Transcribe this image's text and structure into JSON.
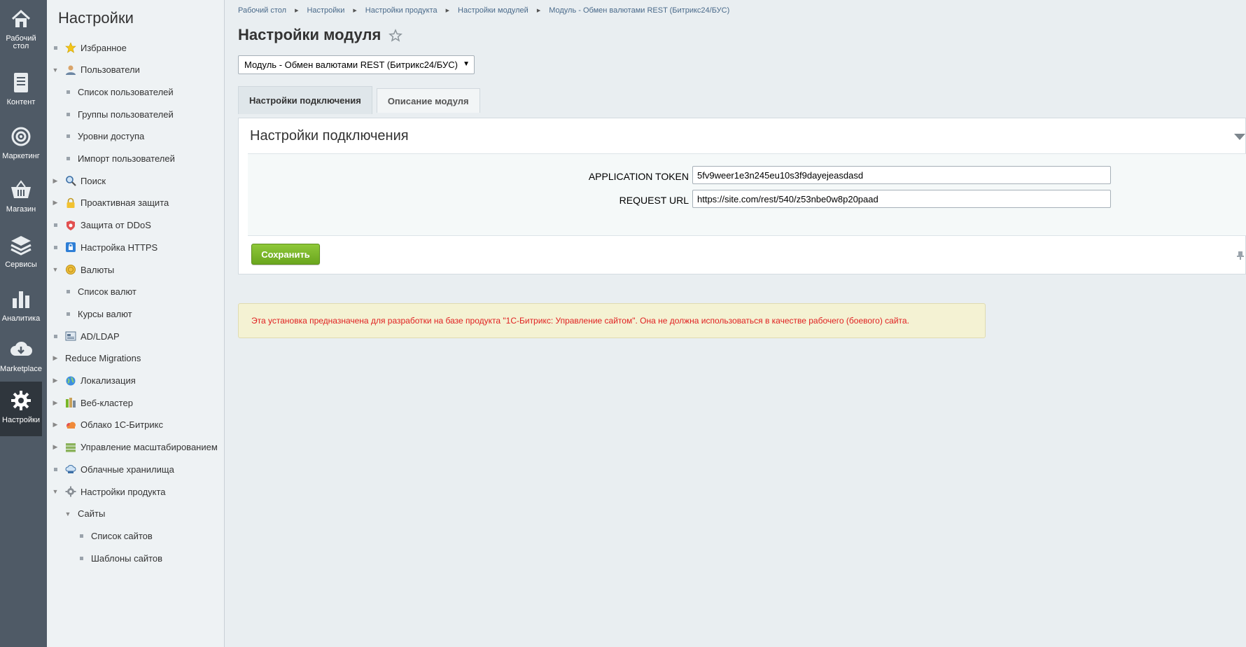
{
  "rail": {
    "items": [
      {
        "label": "Рабочий стол",
        "icon": "home-icon"
      },
      {
        "label": "Контент",
        "icon": "document-icon"
      },
      {
        "label": "Маркетинг",
        "icon": "target-icon"
      },
      {
        "label": "Магазин",
        "icon": "basket-icon"
      },
      {
        "label": "Сервисы",
        "icon": "layers-icon"
      },
      {
        "label": "Аналитика",
        "icon": "bar-chart-icon"
      },
      {
        "label": "Marketplace",
        "icon": "cloud-download-icon"
      },
      {
        "label": "Настройки",
        "icon": "gear-icon",
        "active": true
      }
    ]
  },
  "panel": {
    "title": "Настройки",
    "items": [
      {
        "label": "Избранное",
        "icon": "star-icon",
        "marker": "bullet"
      },
      {
        "label": "Пользователи",
        "icon": "user-icon",
        "marker": "expanded"
      },
      {
        "label": "Список пользователей",
        "marker": "bullet",
        "level": 1
      },
      {
        "label": "Группы пользователей",
        "marker": "bullet",
        "level": 1
      },
      {
        "label": "Уровни доступа",
        "marker": "bullet",
        "level": 1
      },
      {
        "label": "Импорт пользователей",
        "marker": "bullet",
        "level": 1
      },
      {
        "label": "Поиск",
        "icon": "magnifier-icon",
        "marker": "collapsed"
      },
      {
        "label": "Проактивная защита",
        "icon": "lock-icon",
        "marker": "collapsed"
      },
      {
        "label": "Защита от DDoS",
        "icon": "shield-icon",
        "marker": "bullet"
      },
      {
        "label": "Настройка HTTPS",
        "icon": "https-lock-icon",
        "marker": "bullet"
      },
      {
        "label": "Валюты",
        "icon": "coin-icon",
        "marker": "expanded"
      },
      {
        "label": "Список валют",
        "marker": "bullet",
        "level": 1
      },
      {
        "label": "Курсы валют",
        "marker": "bullet",
        "level": 1
      },
      {
        "label": "AD/LDAP",
        "icon": "directory-icon",
        "marker": "bullet"
      },
      {
        "label": "Reduce Migrations",
        "marker": "collapsed"
      },
      {
        "label": "Локализация",
        "icon": "globe-icon",
        "marker": "collapsed"
      },
      {
        "label": "Веб-кластер",
        "icon": "cluster-icon",
        "marker": "collapsed"
      },
      {
        "label": "Облако 1С-Битрикс",
        "icon": "cloud-icon",
        "marker": "collapsed"
      },
      {
        "label": "Управление масштабированием",
        "icon": "servers-icon",
        "marker": "collapsed"
      },
      {
        "label": "Облачные хранилища",
        "icon": "storage-icon",
        "marker": "bullet"
      },
      {
        "label": "Настройки продукта",
        "icon": "settings-gear-icon",
        "marker": "expanded"
      },
      {
        "label": "Сайты",
        "marker": "expanded",
        "level": 1
      },
      {
        "label": "Список сайтов",
        "marker": "bullet",
        "level": 2
      },
      {
        "label": "Шаблоны сайтов",
        "marker": "bullet",
        "level": 2
      }
    ]
  },
  "breadcrumbs": [
    "Рабочий стол",
    "Настройки",
    "Настройки продукта",
    "Настройки модулей",
    "Модуль - Обмен валютами REST (Битрикс24/БУС)"
  ],
  "page_title": "Настройки модуля",
  "module_select": {
    "value": "Модуль - Обмен валютами REST (Битрикс24/БУС)"
  },
  "tabs": [
    "Настройки подключения",
    "Описание модуля"
  ],
  "section": {
    "title": "Настройки подключения",
    "fields": [
      {
        "label": "APPLICATION TOKEN",
        "value": "5fv9weer1e3n245eu10s3f9dayejeasdasd"
      },
      {
        "label": "REQUEST URL",
        "value": "https://site.com/rest/540/z53nbe0w8p20paad"
      }
    ],
    "save_label": "Сохранить"
  },
  "notice": "Эта установка предназначена для разработки на базе продукта \"1С-Битрикс: Управление сайтом\". Она не должна использоваться в качестве рабочего (боевого) сайта.",
  "colors": {
    "accent_green": "#7ab72a",
    "notice_text": "#e02020",
    "rail_bg": "#4f5a66"
  }
}
